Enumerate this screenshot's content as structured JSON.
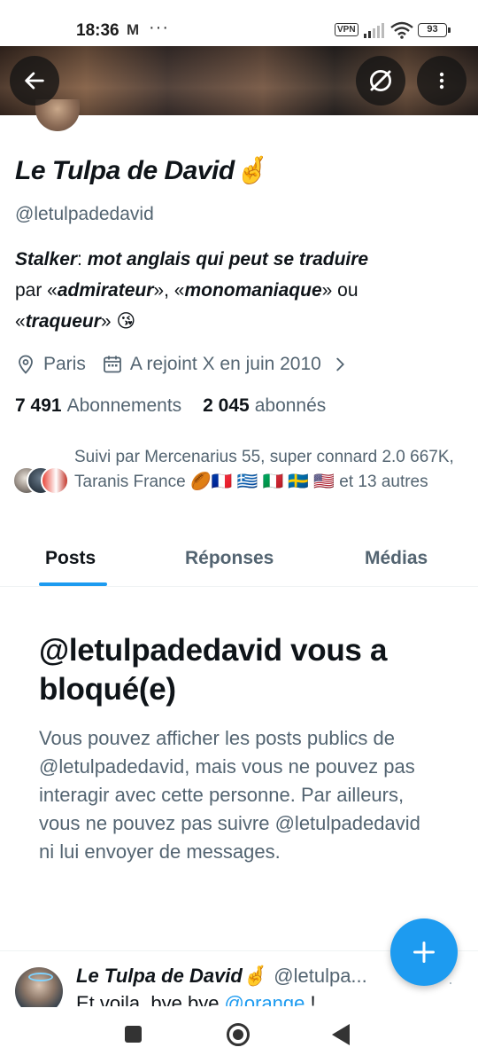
{
  "status_bar": {
    "time": "18:36",
    "mail_icon_label": "M",
    "dots": "···",
    "vpn_label": "VPN",
    "battery": "93"
  },
  "header": {
    "back_icon": "arrow-left-icon",
    "grok_icon": "grok-icon",
    "more_icon": "more-vertical-icon"
  },
  "profile": {
    "display_name": "Le Tulpa de David🤞",
    "handle": "@letulpadedavid",
    "bio_line1_bold": "Stalker",
    "bio_line1_plain": ": ",
    "bio_line1_rest": "mot anglais qui peut se traduire",
    "bio_line2_a": "par «",
    "bio_line2_b": "admirateur",
    "bio_line2_c": "», «",
    "bio_line2_d": "monomaniaque",
    "bio_line2_e": "» ou",
    "bio_line3_a": "«",
    "bio_line3_b": "traqueur",
    "bio_line3_c": "» 😘",
    "location": "Paris",
    "joined": "A rejoint X en juin 2010",
    "following_count": "7 491",
    "following_label": "Abonnements",
    "followers_count": "2 045",
    "followers_label": "abonnés",
    "followed_by": "Suivi par Mercenarius 55, super connard 2.0 667K, Taranis France 🏉🇫🇷 🇬🇷 🇮🇹 🇸🇪 🇺🇸 et 13 autres"
  },
  "tabs": [
    {
      "label": "Posts",
      "active": true
    },
    {
      "label": "Réponses",
      "active": false
    },
    {
      "label": "Médias",
      "active": false
    }
  ],
  "blocked": {
    "title": "@letulpadedavid vous a bloqué(e)",
    "description": "Vous pouvez afficher les posts publics de @letulpadedavid, mais vous ne pouvez pas interagir avec cette personne. Par ailleurs, vous ne pouvez pas suivre @letulpadedavid ni lui envoyer de messages."
  },
  "post": {
    "name": "Le Tulpa de David🤞",
    "handle": "@letulpa...",
    "dot": "·",
    "text_start": "Et voila, bye bye ",
    "text_link": "@orange",
    "text_end": " !"
  },
  "fab": {
    "icon": "plus-icon"
  },
  "colors": {
    "accent": "#1d9bf0",
    "text": "#0f1419",
    "secondary": "#536471"
  }
}
